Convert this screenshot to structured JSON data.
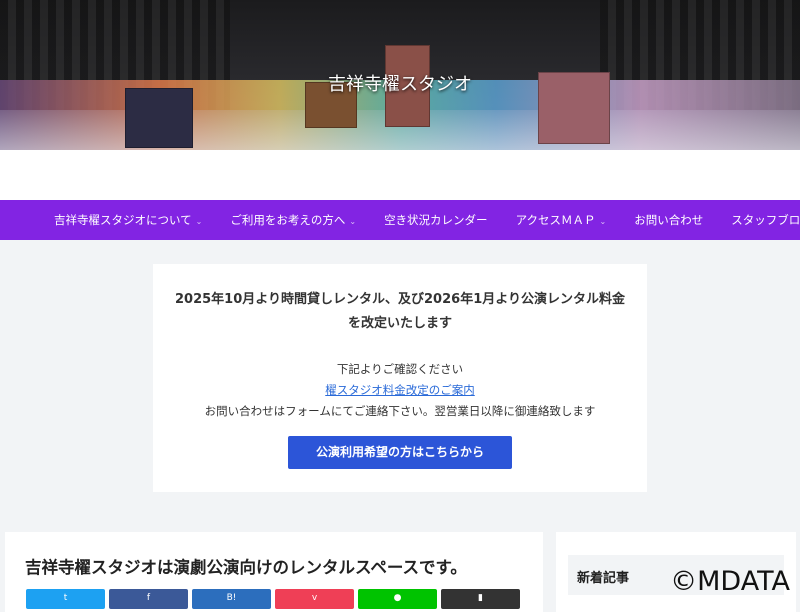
{
  "header": {
    "site_title": "吉祥寺櫂スタジオ"
  },
  "nav": {
    "items": [
      {
        "label": "吉祥寺櫂スタジオについて",
        "has_submenu": true
      },
      {
        "label": "ご利用をお考えの方へ",
        "has_submenu": true
      },
      {
        "label": "空き状況カレンダー",
        "has_submenu": false
      },
      {
        "label": "アクセスＭＡＰ",
        "has_submenu": true
      },
      {
        "label": "お問い合わせ",
        "has_submenu": false
      },
      {
        "label": "スタッフブログ",
        "has_submenu": false
      }
    ],
    "chevron": "⌄"
  },
  "notice": {
    "title": "2025年10月より時間貸しレンタル、及び2026年1月より公演レンタル料金を改定いたします",
    "line1": "下記よりご確認ください",
    "link": "櫂スタジオ料金改定のご案内",
    "line2": "お問い合わせはフォームにてご連絡下さい。翌営業日以降に御連絡致します",
    "button": "公演利用希望の方はこちらから"
  },
  "main": {
    "heading": "吉祥寺櫂スタジオは演劇公演向けのレンタルスペースです。",
    "share": [
      {
        "name": "twitter",
        "glyph": "t",
        "color": "#1da1f2"
      },
      {
        "name": "facebook",
        "glyph": "f",
        "color": "#3b5998"
      },
      {
        "name": "hatena",
        "glyph": "B!",
        "color": "#2c6ebd"
      },
      {
        "name": "pocket",
        "glyph": "v",
        "color": "#ef3f56"
      },
      {
        "name": "line",
        "glyph": "●",
        "color": "#00c300"
      },
      {
        "name": "copy",
        "glyph": "▮",
        "color": "#333333"
      }
    ]
  },
  "sidebar": {
    "heading": "新着記事"
  },
  "watermark": "©MDATA",
  "colors": {
    "nav": "#8224e3",
    "button": "#2c55d8"
  }
}
